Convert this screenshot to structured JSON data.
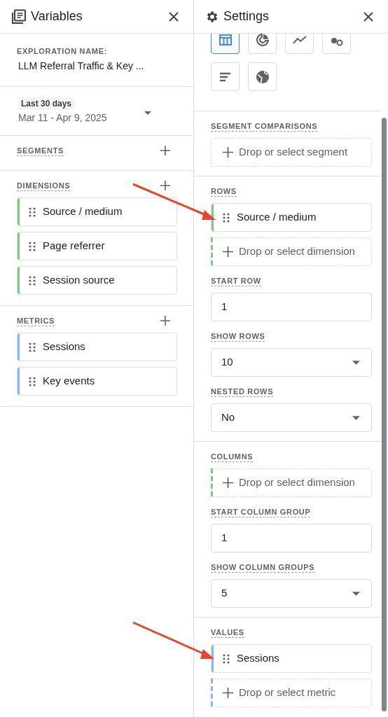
{
  "variables": {
    "title": "Variables",
    "exploration_name": {
      "label": "EXPLORATION NAME:",
      "value": "LLM Referral Traffic & Key ..."
    },
    "date_range": {
      "preset": "Last 30 days",
      "range": "Mar 11 - Apr 9, 2025"
    },
    "sections": [
      {
        "title": "SEGMENTS"
      },
      {
        "title": "DIMENSIONS",
        "items": [
          {
            "label": "Source / medium",
            "color": "#81c784"
          },
          {
            "label": "Page referrer",
            "color": "#81c784"
          },
          {
            "label": "Session source",
            "color": "#81c784"
          }
        ]
      },
      {
        "title": "METRICS",
        "items": [
          {
            "label": "Sessions",
            "color": "#8ab4f8"
          },
          {
            "label": "Key events",
            "color": "#8ab4f8"
          }
        ]
      }
    ]
  },
  "settings": {
    "title": "Settings",
    "viz_types": [
      {
        "kind": "table",
        "selected": true
      },
      {
        "kind": "donut",
        "selected": false
      },
      {
        "kind": "line",
        "selected": false
      },
      {
        "kind": "scatter",
        "selected": false
      },
      {
        "kind": "bar",
        "selected": false
      },
      {
        "kind": "geo",
        "selected": false
      }
    ],
    "groups": [
      [
        {
          "kind": "dropzone",
          "title": "SEGMENT COMPARISONS",
          "placeholder": "Drop or select segment"
        }
      ],
      [
        {
          "kind": "dropzone",
          "title": "ROWS",
          "items": [
            {
              "label": "Source / medium",
              "color": "#81c784"
            }
          ],
          "placeholder": "Drop or select dimension",
          "color": "#81c784"
        },
        {
          "kind": "input",
          "title": "START ROW",
          "value": "1"
        },
        {
          "kind": "select",
          "title": "SHOW ROWS",
          "value": "10"
        },
        {
          "kind": "select",
          "title": "NESTED ROWS",
          "value": "No"
        }
      ],
      [
        {
          "kind": "dropzone",
          "title": "COLUMNS",
          "placeholder": "Drop or select dimension",
          "color": "#81c784"
        },
        {
          "kind": "input",
          "title": "START COLUMN GROUP",
          "value": "1"
        },
        {
          "kind": "select",
          "title": "SHOW COLUMN GROUPS",
          "value": "5"
        }
      ],
      [
        {
          "kind": "dropzone",
          "title": "VALUES",
          "items": [
            {
              "label": "Sessions",
              "color": "#8ab4f8"
            }
          ],
          "placeholder": "Drop or select metric",
          "color": "#8ab4f8"
        }
      ]
    ]
  }
}
